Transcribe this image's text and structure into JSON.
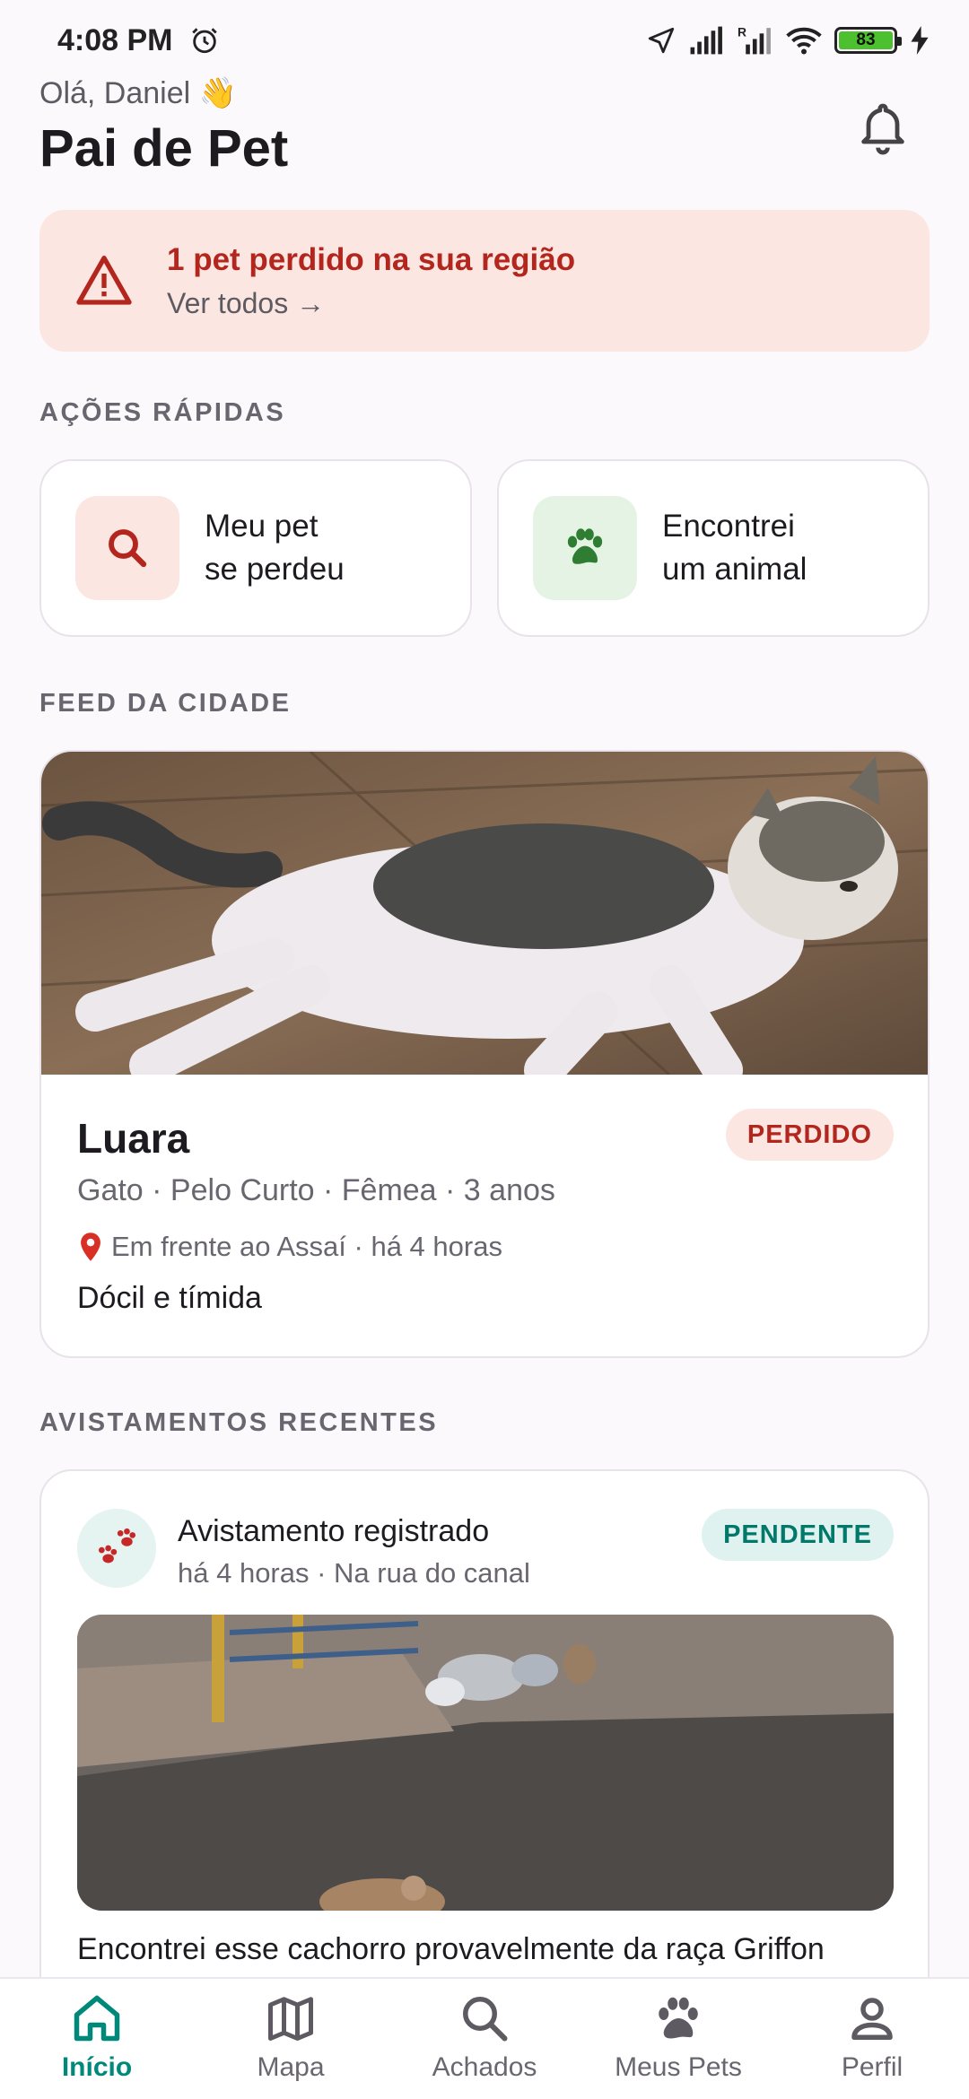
{
  "status_bar": {
    "time": "4:08 PM",
    "battery": "83"
  },
  "header": {
    "greeting": "Olá, Daniel 👋",
    "title": "Pai de Pet"
  },
  "alert": {
    "title": "1 pet perdido na sua região",
    "link": "Ver todos →"
  },
  "sections": {
    "quick_actions": "AÇÕES RÁPIDAS",
    "feed": "FEED DA CIDADE",
    "sightings": "AVISTAMENTOS RECENTES"
  },
  "quick_actions": [
    {
      "line1": "Meu pet",
      "line2": "se perdeu"
    },
    {
      "line1": "Encontrei",
      "line2": "um animal"
    }
  ],
  "feed_post": {
    "name": "Luara",
    "status": "PERDIDO",
    "description": "Gato · Pelo Curto · Fêmea · 3 anos",
    "location": "Em frente ao Assaí · há 4 horas",
    "note": "Dócil e tímida"
  },
  "sighting": {
    "title": "Avistamento registrado",
    "subtitle": "há 4 horas · Na rua do canal",
    "status": "PENDENTE",
    "text": "Encontrei esse cachorro provavelmente da raça Griffon"
  },
  "nav": [
    {
      "label": "Início",
      "active": true
    },
    {
      "label": "Mapa"
    },
    {
      "label": "Achados"
    },
    {
      "label": "Meus Pets"
    },
    {
      "label": "Perfil"
    }
  ],
  "colors": {
    "accent": "#00897B",
    "danger": "#B3261E",
    "alert_bg": "#FCE6E1"
  }
}
